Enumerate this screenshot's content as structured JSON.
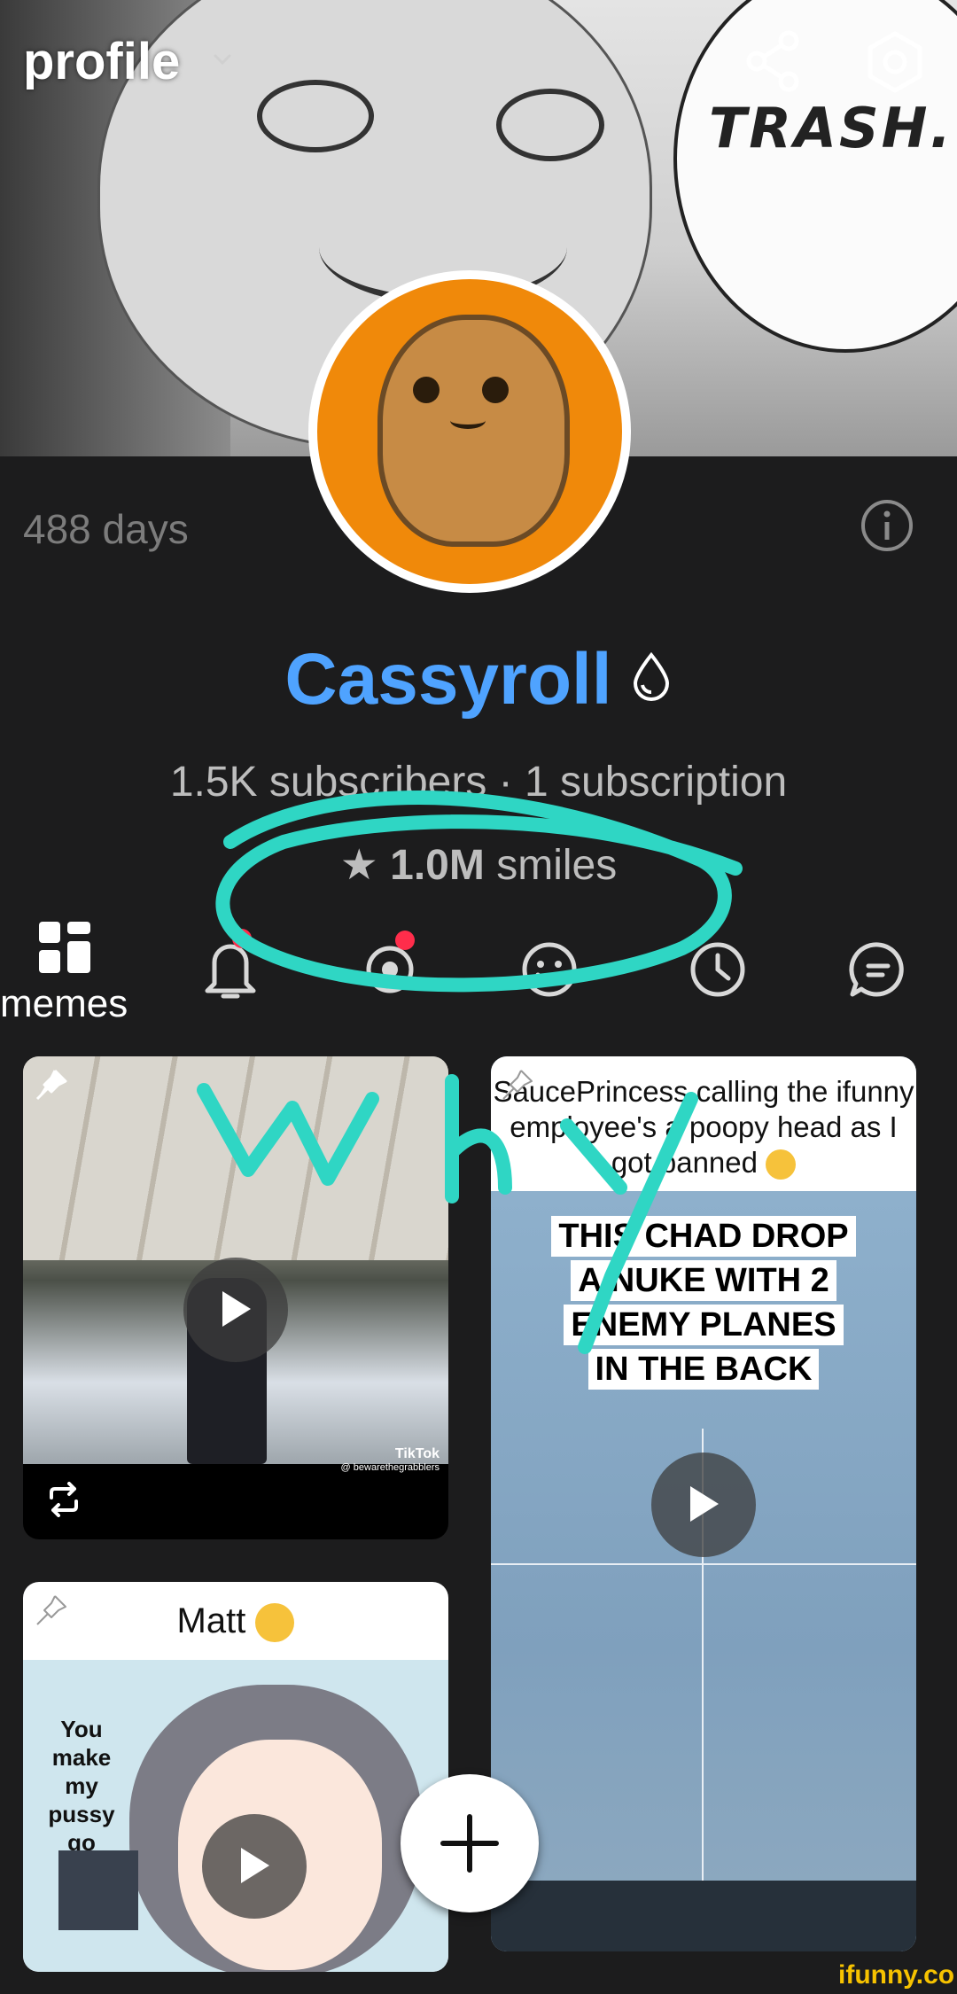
{
  "header": {
    "title": "profile",
    "banner_text": "TRASH."
  },
  "profile": {
    "days": "488 days",
    "username": "Cassyroll",
    "username_color": "#4fa3ff",
    "subscribers": "1.5K subscribers",
    "separator": "·",
    "subscriptions": "1 subscription",
    "smiles_count": "1.0M",
    "smiles_label": "smiles"
  },
  "tabs": [
    {
      "label": "memes",
      "icon": "grid-icon",
      "active": true
    },
    {
      "label": "",
      "icon": "bell-icon",
      "badge": true
    },
    {
      "label": "",
      "icon": "eye-icon",
      "badge": true
    },
    {
      "label": "",
      "icon": "smile-icon"
    },
    {
      "label": "",
      "icon": "clock-icon"
    },
    {
      "label": "",
      "icon": "chat-icon"
    }
  ],
  "posts": [
    {
      "pinned": true,
      "type": "video",
      "watermark": "TikTok",
      "watermark_handle": "@ bewarethegrabblers",
      "repost": true
    },
    {
      "pinned": true,
      "type": "video",
      "caption": "SaucePrincess calling the ifunny employee's a poopy head as I got banned",
      "overlay_lines": [
        "THIS CHAD DROP",
        "A NUKE WITH 2",
        "ENEMY PLANES",
        "IN THE BACK"
      ]
    },
    {
      "pinned": true,
      "type": "video",
      "caption": "Matt",
      "side_text": "You make my pussy go"
    }
  ],
  "annotations": {
    "scribble_text": "Why",
    "scribble_color": "#2fd6c4"
  },
  "watermark": "ifunny.co",
  "colors": {
    "background": "#1c1c1d",
    "badge": "#ff2d4b",
    "avatar_bg": "#f0890a"
  }
}
